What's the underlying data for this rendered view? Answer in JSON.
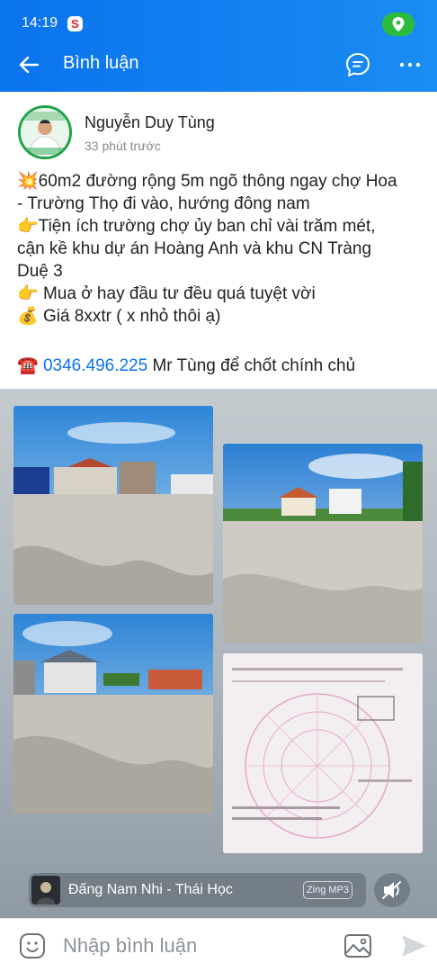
{
  "status": {
    "time": "14:19",
    "app_icon": "S"
  },
  "header": {
    "title": "Bình luận",
    "back_icon": "arrow-left-icon",
    "chat_icon": "chat-bubble-icon",
    "more_icon": "more-dots-icon",
    "accent": "#0a73ee"
  },
  "post": {
    "author": "Nguyễn Duy Tùng",
    "timestamp": "33 phút trước",
    "lines": [
      {
        "emoji": "💥",
        "text": "60m2 đường rộng 5m ngõ thông ngay chợ Hoa"
      },
      {
        "emoji": "",
        "text": "- Trường Thọ đi vào, hướng đông nam"
      },
      {
        "emoji": "👉",
        "text": "Tiện ích trường chợ ủy ban chỉ vài trăm mét,"
      },
      {
        "emoji": "",
        "text": "cận kề khu dự án Hoàng Anh và khu CN Tràng"
      },
      {
        "emoji": "",
        "text": "Duệ 3"
      },
      {
        "emoji": "👉",
        "text": " Mua ở hay đầu tư đều quá tuyệt vời"
      },
      {
        "emoji": "💰",
        "text": " Giá 8xxtr ( x nhỏ thôi ạ)"
      }
    ],
    "phone_emoji": "☎️",
    "phone": "0346.496.225",
    "phone_suffix": " Mr Tùng để chốt chính chủ",
    "phone_color": "#0a73ee"
  },
  "gallery": {
    "photos": [
      {
        "name": "land-photo-1"
      },
      {
        "name": "land-photo-2"
      },
      {
        "name": "land-photo-3"
      },
      {
        "name": "land-certificate-photo"
      }
    ]
  },
  "music": {
    "title": "Đấng Nam Nhi - Thái Học",
    "badge": "Zing MP3",
    "mute_icon": "speaker-muted-icon"
  },
  "composer": {
    "placeholder": "Nhập bình luận",
    "emoji_icon": "emoji-icon",
    "image_icon": "image-icon",
    "send_icon": "send-icon"
  }
}
